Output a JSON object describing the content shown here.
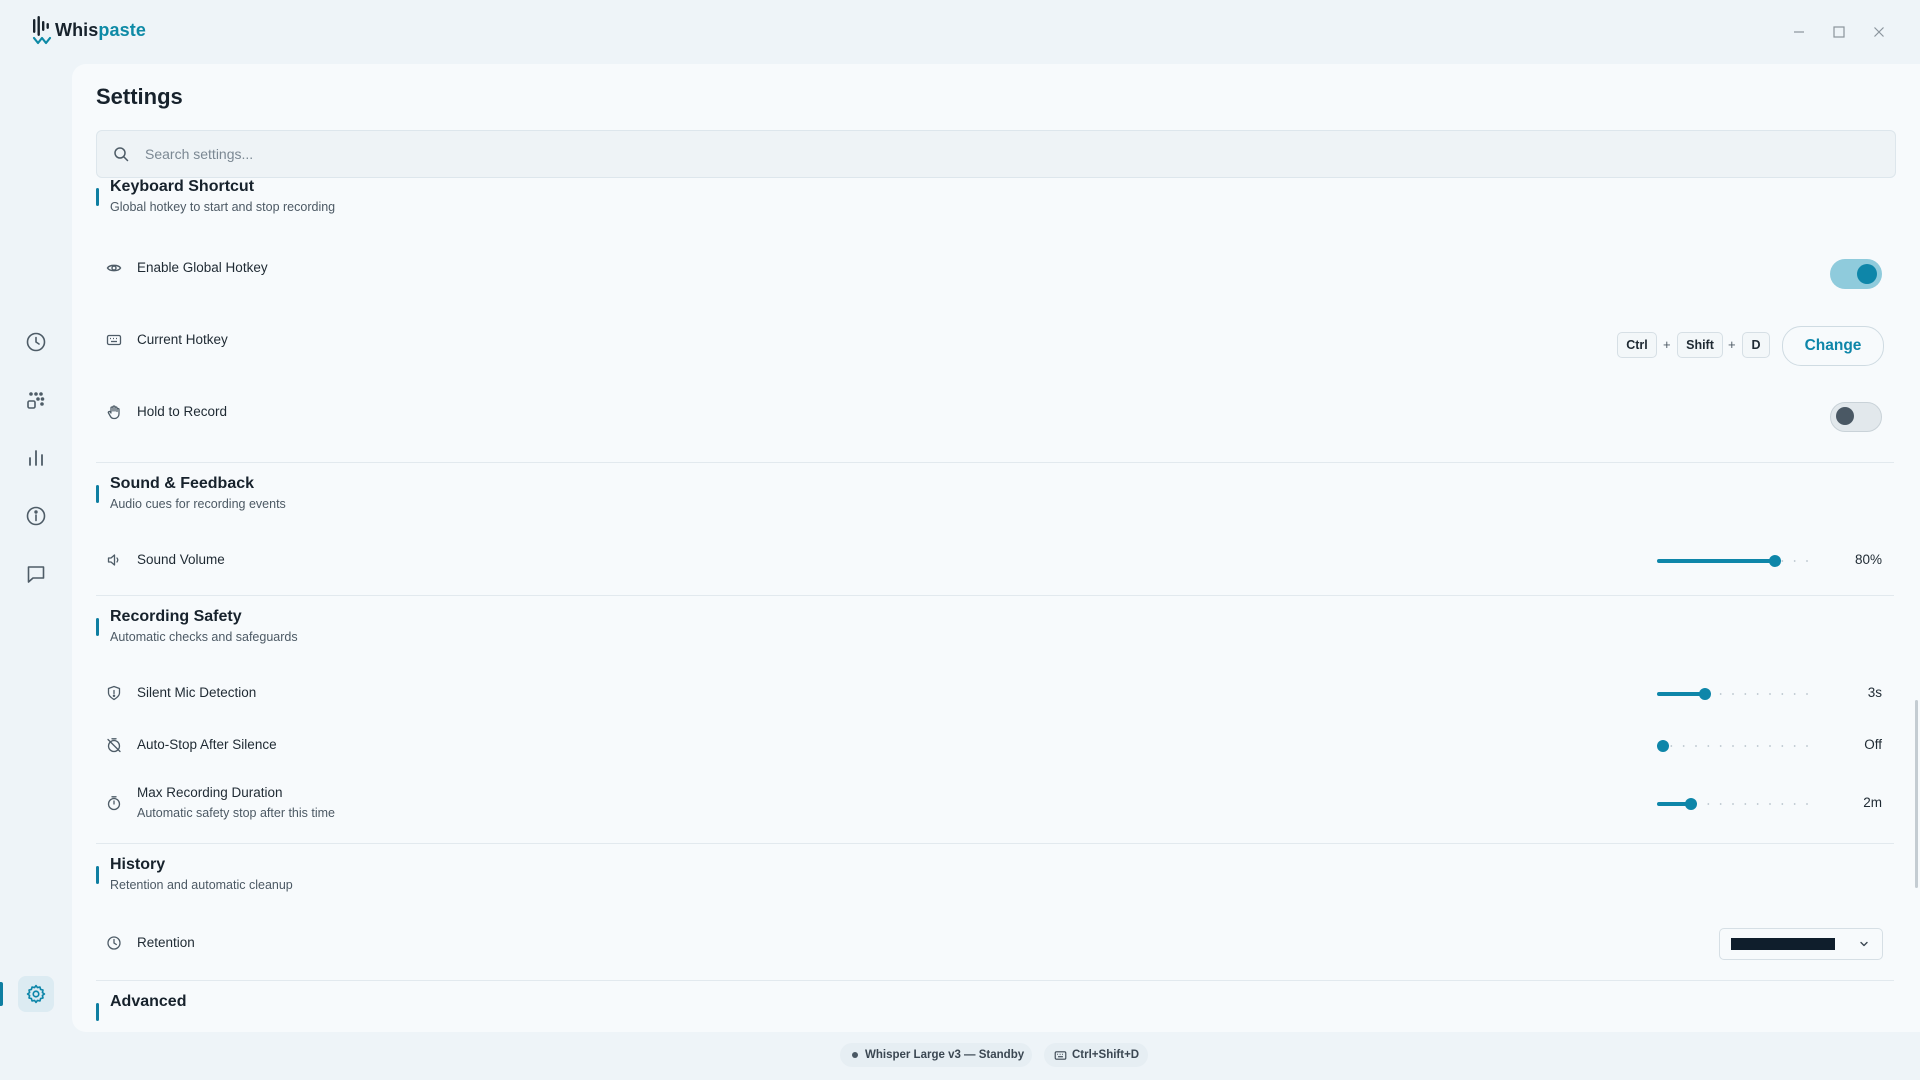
{
  "app": {
    "name_part1": "Whis",
    "name_part2": "paste",
    "accent": "#0e86a9"
  },
  "window_controls": {
    "minimize_icon": "minimize-icon",
    "maximize_icon": "maximize-icon",
    "close_icon": "close-icon"
  },
  "sidebar": {
    "items": [
      {
        "name": "history",
        "icon": "clock-icon",
        "active": false
      },
      {
        "name": "dictionary",
        "icon": "grid-dots-icon",
        "active": false
      },
      {
        "name": "stats",
        "icon": "bar-chart-icon",
        "active": false
      },
      {
        "name": "about",
        "icon": "info-icon",
        "active": false
      },
      {
        "name": "feedback",
        "icon": "chat-icon",
        "active": false
      },
      {
        "name": "settings",
        "icon": "gear-icon",
        "active": true
      }
    ]
  },
  "page": {
    "title": "Settings",
    "search_placeholder": "Search settings..."
  },
  "sections": {
    "keyboard": {
      "title": "Keyboard Shortcut",
      "subtitle": "Global hotkey to start and stop recording",
      "enable_label": "Enable Global Hotkey",
      "enable_on": true,
      "hotkey_label": "Current Hotkey",
      "keys": [
        "Ctrl",
        "Shift",
        "D"
      ],
      "plus": "+",
      "change_label": "Change",
      "hold_label": "Hold to Record",
      "hold_on": false
    },
    "sound": {
      "title": "Sound & Feedback",
      "subtitle": "Audio cues for recording events",
      "volume_label": "Sound Volume",
      "volume_value": "80%",
      "volume_fraction": 0.8
    },
    "safety": {
      "title": "Recording Safety",
      "subtitle": "Automatic checks and safeguards",
      "silent_label": "Silent Mic Detection",
      "silent_value": "3s",
      "silent_fraction": 0.3,
      "autostop_label": "Auto-Stop After Silence",
      "autostop_value": "Off",
      "autostop_fraction": 0.0,
      "maxdur_label": "Max Recording Duration",
      "maxdur_sub": "Automatic safety stop after this time",
      "maxdur_value": "2m",
      "maxdur_fraction": 0.2
    },
    "history": {
      "title": "History",
      "subtitle": "Retention and automatic cleanup",
      "retention_label": "Retention"
    },
    "advanced": {
      "title": "Advanced"
    }
  },
  "status": {
    "model": "Whisper Large v3 — Standby",
    "hotkey": "Ctrl+Shift+D"
  }
}
